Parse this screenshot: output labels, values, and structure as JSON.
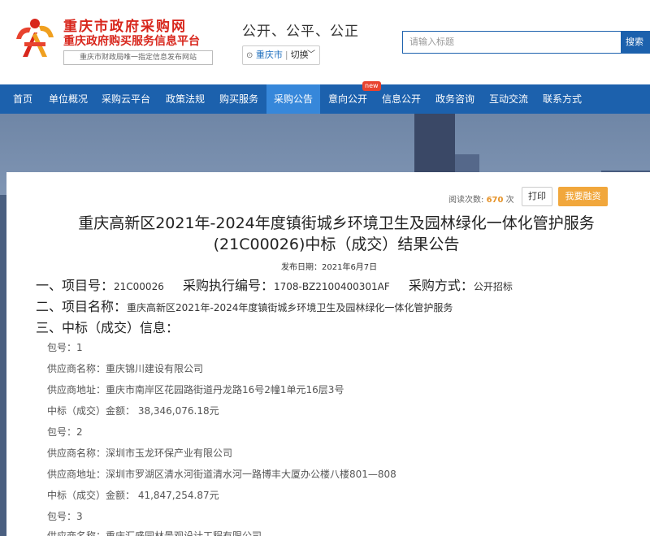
{
  "header": {
    "site_title": "重庆市政府采购网",
    "site_subtitle": "重庆政府购买服务信息平台",
    "site_tagline": "重庆市财政局唯一指定信息发布网站",
    "slogan": "公开、公平、公正",
    "city": "重庆市",
    "switch_label": "切换",
    "search_placeholder": "请输入标题",
    "search_button": "搜索"
  },
  "nav": {
    "items": [
      "首页",
      "单位概况",
      "采购云平台",
      "政策法规",
      "购买服务",
      "采购公告",
      "意向公开",
      "信息公开",
      "政务咨询",
      "互动交流",
      "联系方式"
    ],
    "active": "采购公告",
    "badge": "new"
  },
  "article": {
    "views_label": "阅读次数:",
    "views_count": "670",
    "views_unit": "次",
    "print_button": "打印",
    "finance_button": "我要融资",
    "title": "重庆高新区2021年-2024年度镇街城乡环境卫生及园林绿化一体化管护服务(21C00026)中标（成交）结果公告",
    "publish_label": "发布日期：",
    "publish_date": "2021年6月7日",
    "section1": {
      "label": "一、项目号：",
      "value": "21C00026",
      "label2": "采购执行编号：",
      "value2": "1708-BZ2100400301AF",
      "label3": "采购方式：",
      "value3": "公开招标"
    },
    "section2": {
      "label": "二、项目名称：",
      "value": "重庆高新区2021年-2024年度镇街城乡环境卫生及园林绿化一体化管护服务"
    },
    "section3": {
      "label": "三、中标（成交）信息："
    },
    "rows": [
      "包号：1",
      "供应商名称：重庆锦川建设有限公司",
      "供应商地址：重庆市南岸区花园路街道丹龙路16号2幢1单元16层3号",
      "中标（成交）金额： 38,346,076.18元",
      "包号：2",
      "供应商名称：深圳市玉龙环保产业有限公司",
      "供应商地址：深圳市罗湖区清水河街道清水河一路博丰大厦办公楼八楼801—808",
      "中标（成交）金额： 41,847,254.87元",
      "包号：3",
      "供应商名称：重庆汇盛园林景观设计工程有限公司"
    ]
  },
  "colors": {
    "brand_red": "#d8261c",
    "nav_blue": "#1c61ad",
    "nav_active": "#3687da",
    "finance_orange": "#f1a73c"
  },
  "icons": [
    "logo-emblem-icon",
    "location-pin-icon",
    "chevron-down-icon"
  ]
}
